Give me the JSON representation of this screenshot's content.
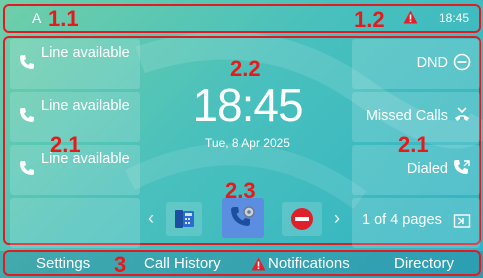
{
  "status_bar": {
    "account_letter": "A",
    "time": "18:45",
    "warning_icon": "warning-icon"
  },
  "lines": [
    {
      "label": "Line available",
      "icon": "phone-icon"
    },
    {
      "label": "Line available",
      "icon": "phone-icon"
    },
    {
      "label": "Line available",
      "icon": "phone-icon"
    }
  ],
  "clock": {
    "time": "18:45",
    "date": "Tue, 8 Apr 2025"
  },
  "right_keys": [
    {
      "label": "DND",
      "icon": "dnd-icon"
    },
    {
      "label": "Missed Calls",
      "icon": "missed-calls-icon"
    },
    {
      "label": "Dialed",
      "icon": "dialed-icon"
    }
  ],
  "apps": [
    {
      "name": "Directory",
      "icon": "directory-app-icon"
    },
    {
      "name": "Call Settings",
      "icon": "call-settings-app-icon"
    },
    {
      "name": "DND",
      "icon": "dnd-app-icon"
    }
  ],
  "pager": {
    "label": "1 of 4 pages",
    "icon": "page-switch-icon"
  },
  "softkeys": [
    "Settings",
    "Call History",
    "Notifications",
    "Directory"
  ],
  "annotations": [
    "1.1",
    "1.2",
    "2.2",
    "2.1",
    "2.1",
    "2.3",
    "3"
  ],
  "colors": {
    "annotation": "#e51b1b",
    "dnd_red": "#e0202a",
    "app_highlight": "#5b8ee0"
  }
}
